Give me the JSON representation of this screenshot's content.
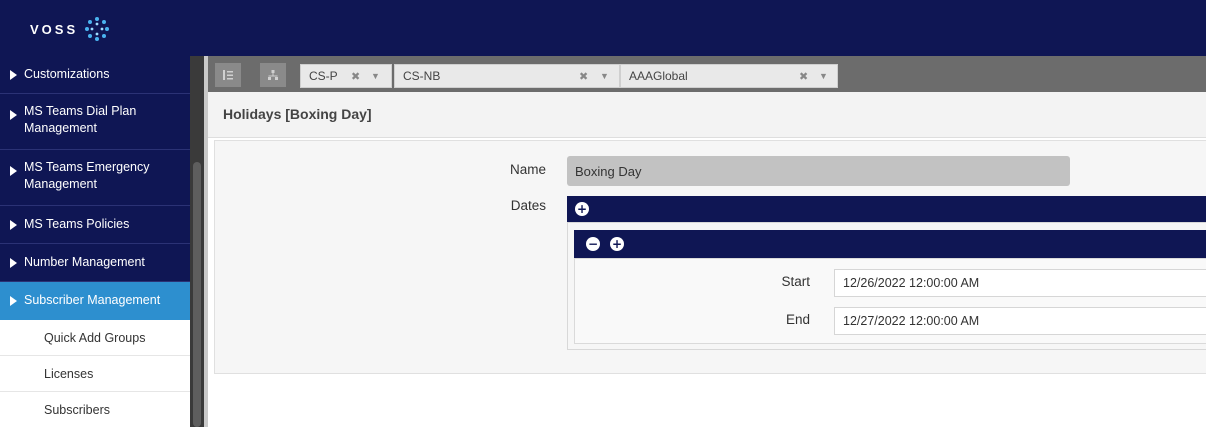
{
  "header": {
    "logo_text": "VOSS"
  },
  "sidebar": {
    "items": [
      {
        "label": "Customizations"
      },
      {
        "label": "MS Teams Dial Plan Management"
      },
      {
        "label": "MS Teams Emergency Management"
      },
      {
        "label": "MS Teams Policies"
      },
      {
        "label": "Number Management"
      },
      {
        "label": "Subscriber Management"
      }
    ],
    "sub_items": [
      {
        "label": "Quick Add Groups"
      },
      {
        "label": "Licenses"
      },
      {
        "label": "Subscribers"
      }
    ]
  },
  "toolbar": {
    "hierarchy": [
      {
        "label": "CS-P"
      },
      {
        "label": "CS-NB"
      },
      {
        "label": "AAAGlobal"
      }
    ]
  },
  "page": {
    "title": "Holidays [Boxing Day]"
  },
  "form": {
    "name_label": "Name",
    "name_value": "Boxing Day",
    "dates_label": "Dates",
    "start_label": "Start",
    "start_value": "12/26/2022 12:00:00 AM",
    "end_label": "End",
    "end_value": "12/27/2022 12:00:00 AM"
  },
  "colors": {
    "navy": "#0f1654",
    "active_blue": "#2d8fcf",
    "toolbar_gray": "#6c6c6c"
  }
}
